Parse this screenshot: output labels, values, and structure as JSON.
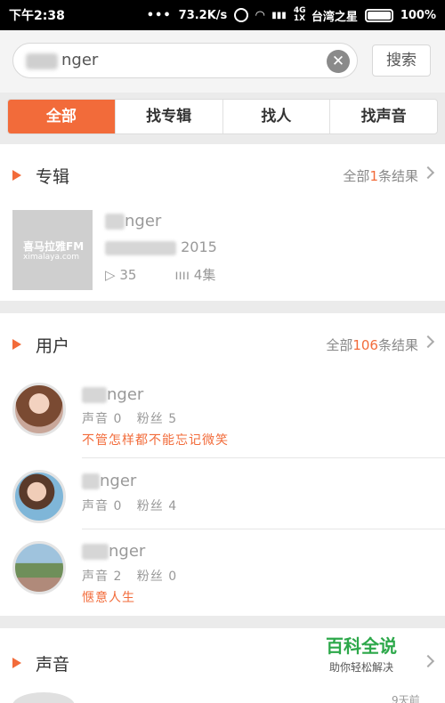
{
  "status": {
    "time": "下午2:38",
    "speed": "73.2K/s",
    "network": "4G 1X",
    "carrier": "台湾之星",
    "battery": "100%"
  },
  "search": {
    "query": "nger",
    "button": "搜索"
  },
  "tabs": [
    {
      "label": "全部"
    },
    {
      "label": "找专辑"
    },
    {
      "label": "找人"
    },
    {
      "label": "找声音"
    }
  ],
  "albums": {
    "title": "专辑",
    "more_prefix": "全部",
    "more_count": "1",
    "more_suffix": "条结果",
    "item": {
      "name": "nger",
      "year": "2015",
      "plays": "35",
      "episodes": "4集",
      "cover_logo": "喜马拉雅FM",
      "cover_domain": "ximalaya.com"
    }
  },
  "users": {
    "title": "用户",
    "more_prefix": "全部",
    "more_count": "106",
    "more_suffix": "条结果",
    "items": [
      {
        "name": "nger",
        "sound_label": "声音",
        "sounds": "0",
        "fans_label": "粉丝",
        "fans": "5",
        "signature": "不管怎样都不能忘记微笑"
      },
      {
        "name": "nger",
        "sound_label": "声音",
        "sounds": "0",
        "fans_label": "粉丝",
        "fans": "4",
        "signature": ""
      },
      {
        "name": "nger",
        "sound_label": "声音",
        "sounds": "2",
        "fans_label": "粉丝",
        "fans": "0",
        "signature": "惬意人生"
      }
    ]
  },
  "sounds": {
    "title": "声音",
    "partial_time": "9天前"
  },
  "watermark": {
    "big": "百科全说",
    "small": "助你轻松解决"
  },
  "colors": {
    "accent": "#f26b3a"
  }
}
